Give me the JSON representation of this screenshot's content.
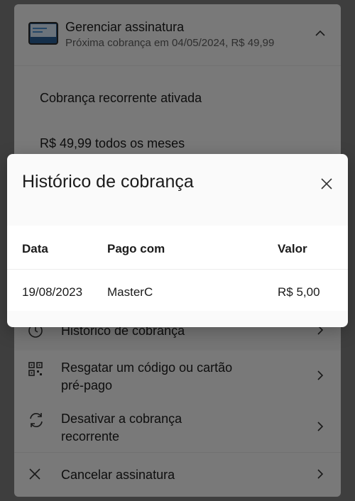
{
  "subscription": {
    "title": "Gerenciar assinatura",
    "next_charge": "Próxima cobrança em 04/05/2024, R$ 49,99",
    "recurring_status": "Cobrança recorrente ativada",
    "price": "R$ 49,99 todos os meses"
  },
  "menu": {
    "billing_history": "Histórico de cobrança",
    "redeem_line1": "Resgatar um código ou cartão",
    "redeem_line2": "pré-pago",
    "disable_line1": "Desativar a cobrança",
    "disable_line2": "recorrente",
    "cancel": "Cancelar assinatura"
  },
  "dialog": {
    "title": "Histórico de cobrança",
    "columns": {
      "date": "Data",
      "paid_with": "Pago com",
      "value": "Valor"
    },
    "rows": [
      {
        "date": "19/08/2023",
        "paid_with": "MasterC",
        "value": "R$ 5,00"
      }
    ]
  },
  "colors": {
    "panel": "#f3f3f3",
    "dialog": "#fafafa",
    "card_accent": "#1f6fb5"
  },
  "icons": [
    "card-icon",
    "chevron-up-icon",
    "clock-icon",
    "qr-code-icon",
    "refresh-icon",
    "close-icon",
    "chevron-right-icon"
  ]
}
